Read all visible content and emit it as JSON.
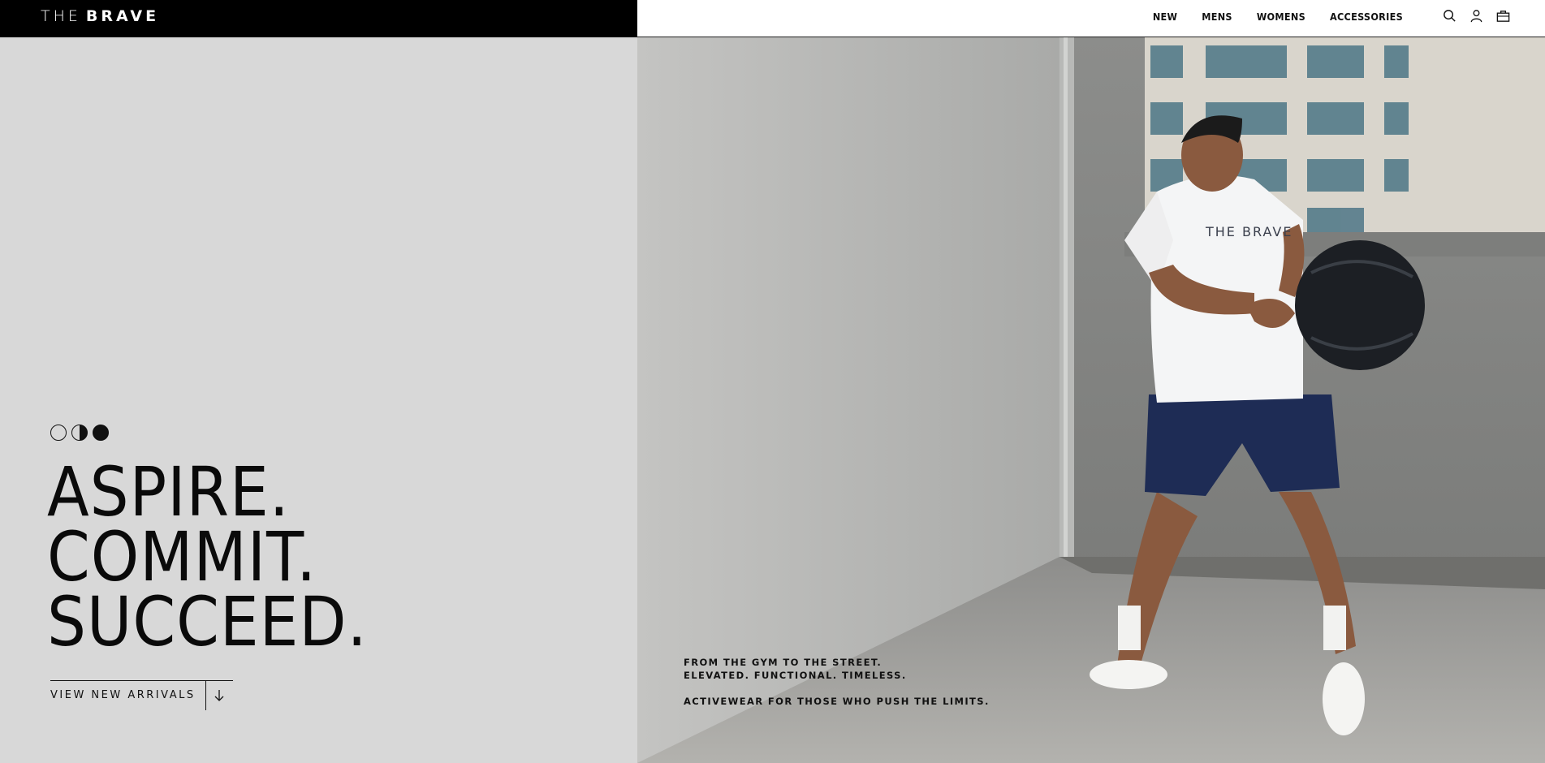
{
  "brand": {
    "logo_light": "THE",
    "logo_bold": "BRAVE"
  },
  "nav": {
    "items": [
      "NEW",
      "MENS",
      "WOMENS",
      "ACCESSORIES"
    ]
  },
  "icons": {
    "search": "search-icon",
    "account": "user-icon",
    "cart": "bag-icon"
  },
  "hero": {
    "phase_icons": [
      "empty-circle",
      "half-circle",
      "full-circle"
    ],
    "headline": [
      "ASPIRE.",
      "COMMIT.",
      "SUCCEED."
    ],
    "cta_label": "VIEW NEW ARRIVALS",
    "tagline_lines": [
      "FROM THE GYM TO THE STREET.",
      "ELEVATED. FUNCTIONAL. TIMELESS."
    ],
    "tagline_footer": "ACTIVEWEAR FOR  THOSE WHO PUSH THE LIMITS."
  },
  "photo": {
    "shirt_print": "THE BRAVE"
  },
  "colors": {
    "header_black": "#000000",
    "panel_grey": "#d8d8d8",
    "text_dark": "#111111"
  }
}
